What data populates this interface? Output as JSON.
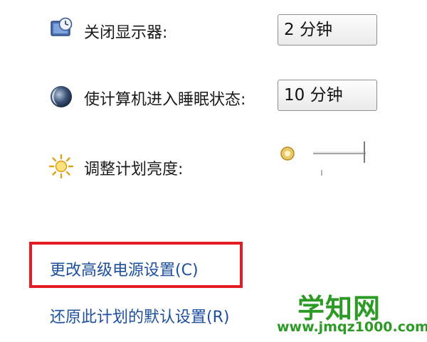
{
  "settings": {
    "display_off": {
      "icon": "monitor-clock-icon",
      "label": "关闭显示器:",
      "value": "2 分钟"
    },
    "sleep": {
      "icon": "moon-icon",
      "label": "使计算机进入睡眠状态:",
      "value": "10 分钟"
    },
    "brightness": {
      "icon": "sun-icon",
      "label": "调整计划亮度:",
      "slider_icon": "dim-sun-icon"
    }
  },
  "links": {
    "advanced": "更改高级电源设置(C)",
    "restore": "还原此计划的默认设置(R)"
  },
  "watermark": {
    "main": "学知网",
    "sub": "www.jmqz1000.com"
  },
  "colors": {
    "link": "#1d4f9c",
    "highlight": "#e41b23",
    "watermark": "#2e9a26"
  }
}
